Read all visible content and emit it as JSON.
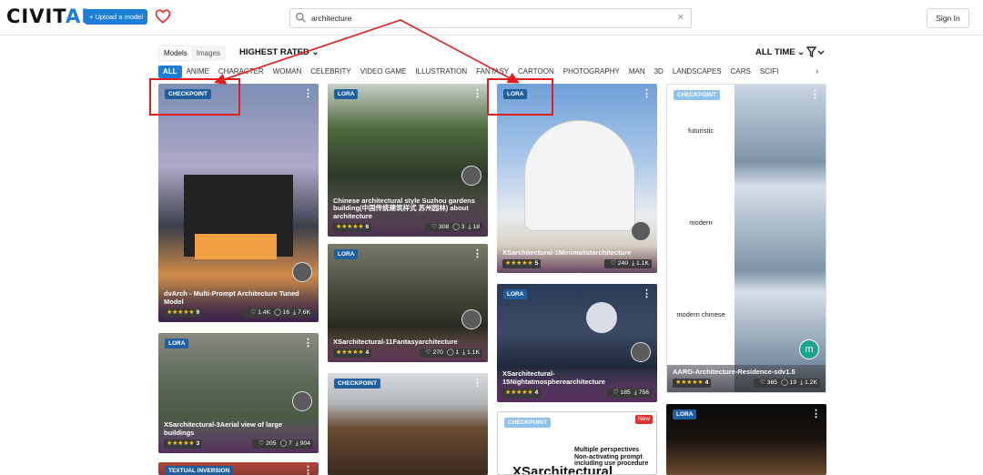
{
  "header": {
    "logo_main": "CIVIT",
    "logo_accent": "AI",
    "upload_label": "+ Upload a model",
    "search_value": "architecture",
    "clear_symbol": "✕",
    "signin_label": "Sign In"
  },
  "toolbar": {
    "models_label": "Models",
    "images_label": "Images",
    "sort_label": "HIGHEST RATED ⌄",
    "period_label": "ALL TIME ⌄"
  },
  "categories": [
    "ALL",
    "ANIME",
    "CHARACTER",
    "WOMAN",
    "CELEBRITY",
    "VIDEO GAME",
    "ILLUSTRATION",
    "FANTASY",
    "CARTOON",
    "PHOTOGRAPHY",
    "MAN",
    "3D",
    "LANDSCAPES",
    "CARS",
    "SCIFI"
  ],
  "categories_next": "›",
  "cards": [
    {
      "type": "CHECKPOINT",
      "title": "dvArch - Multi-Prompt Architecture Tuned Model",
      "stars": "★★★★★",
      "rating_count": "9",
      "likes": "♡ 1.4K",
      "comments": "◯ 16",
      "downloads": "⤓ 7.6K"
    },
    {
      "type": "LORA",
      "title": "Chinese architectural style Suzhou gardens building(中国传统建筑样式 苏州园林) about architecture",
      "stars": "★★★★★",
      "rating_count": "6",
      "likes": "♡ 308",
      "comments": "◯ 3",
      "downloads": "⤓ 18"
    },
    {
      "type": "LORA",
      "title": "XSarchitectural-1Minimalistarchitecture",
      "stars": "★★★★★",
      "rating_count": "5",
      "likes": "♡ 240",
      "comments": "",
      "downloads": "⤓ 1.1K"
    },
    {
      "type": "CHECKPOINT",
      "title": "AARG-Architecture-Residence-sdv1.5",
      "stars": "★★★★★",
      "rating_count": "4",
      "likes": "♡ 365",
      "comments": "◯ 19",
      "downloads": "⤓ 1.2K",
      "panel_labels": [
        "futuristic",
        "modern",
        "modern chinese"
      ],
      "avatar_letter": "m"
    },
    {
      "type": "LORA",
      "title": "XSarchitectural-11Fantasyarchitecture",
      "stars": "★★★★★",
      "rating_count": "4",
      "likes": "♡ 270",
      "comments": "◯ 1",
      "downloads": "⤓ 1.1K"
    },
    {
      "type": "LORA",
      "title": "XSarchitectural-15Nightatmospherearchitecture",
      "stars": "★★★★★",
      "rating_count": "4",
      "likes": "♡ 185",
      "comments": "",
      "downloads": "⤓ 756"
    },
    {
      "type": "LORA",
      "title": "XSarchitectural-3Aerial view of large buildings",
      "stars": "★★★★★",
      "rating_count": "3",
      "likes": "♡ 205",
      "comments": "◯ 7",
      "downloads": "⤓ 904"
    },
    {
      "type": "CHECKPOINT"
    },
    {
      "type": "CHECKPOINT",
      "new_label": "New",
      "sketch_line1": "Multiple perspectives",
      "sketch_line2": "Non-activating prompt",
      "sketch_line3": "including use procedure",
      "sketch_big": "XSarchitectural"
    },
    {
      "type": "LORA"
    },
    {
      "type": "TEXTUAL INVERSION"
    }
  ]
}
